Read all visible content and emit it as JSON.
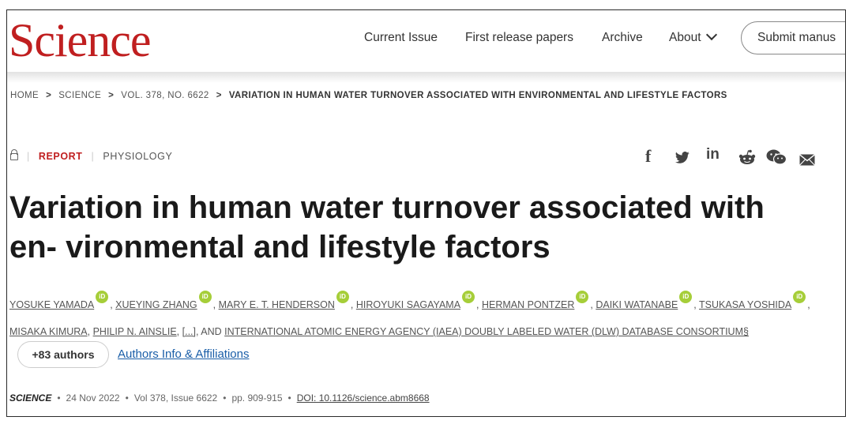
{
  "header": {
    "logo": "Science",
    "nav": {
      "current_issue": "Current Issue",
      "first_release": "First release papers",
      "archive": "Archive",
      "about": "About"
    },
    "submit_label": "Submit manus"
  },
  "breadcrumb": {
    "home": "HOME",
    "science": "SCIENCE",
    "volume": "VOL. 378, NO. 6622",
    "current": "VARIATION IN HUMAN WATER TURNOVER ASSOCIATED WITH ENVIRONMENTAL AND LIFESTYLE FACTORS",
    "sep": ">"
  },
  "article_meta": {
    "type": "REPORT",
    "subject": "PHYSIOLOGY"
  },
  "share_icons": {
    "facebook": "f",
    "twitter": "twitter-icon",
    "linkedin": "in",
    "reddit": "reddit-icon",
    "wechat": "wechat-icon",
    "email": "email-icon"
  },
  "title": "Variation in human water turnover associated with en- vironmental and lifestyle factors",
  "authors": {
    "list": [
      "YOSUKE YAMADA",
      "XUEYING ZHANG",
      "MARY E. T. HENDERSON",
      "HIROYUKI SAGAYAMA",
      "HERMAN PONTZER",
      "DAIKI WATANABE",
      "TSUKASA YOSHIDA",
      "MISAKA KIMURA",
      "PHILIP N. AINSLIE"
    ],
    "ellipsis": "[...]",
    "and": "AND",
    "consortium": "INTERNATIONAL ATOMIC ENERGY AGENCY (IAEA) DOUBLY LABELED WATER (DLW) DATABASE CONSORTIUM§",
    "orcid_label": "iD",
    "more_authors": "+83 authors",
    "affiliations_link": "Authors Info & Affiliations"
  },
  "citation": {
    "journal": "SCIENCE",
    "date": "24 Nov 2022",
    "volume": "Vol 378, Issue 6622",
    "pages": "pp. 909-915",
    "doi": "DOI: 10.1126/science.abm8668",
    "sep": "•"
  },
  "colors": {
    "brand_red": "#c01f20",
    "link_blue": "#1a5ea8",
    "orcid_green": "#a6ce39"
  }
}
